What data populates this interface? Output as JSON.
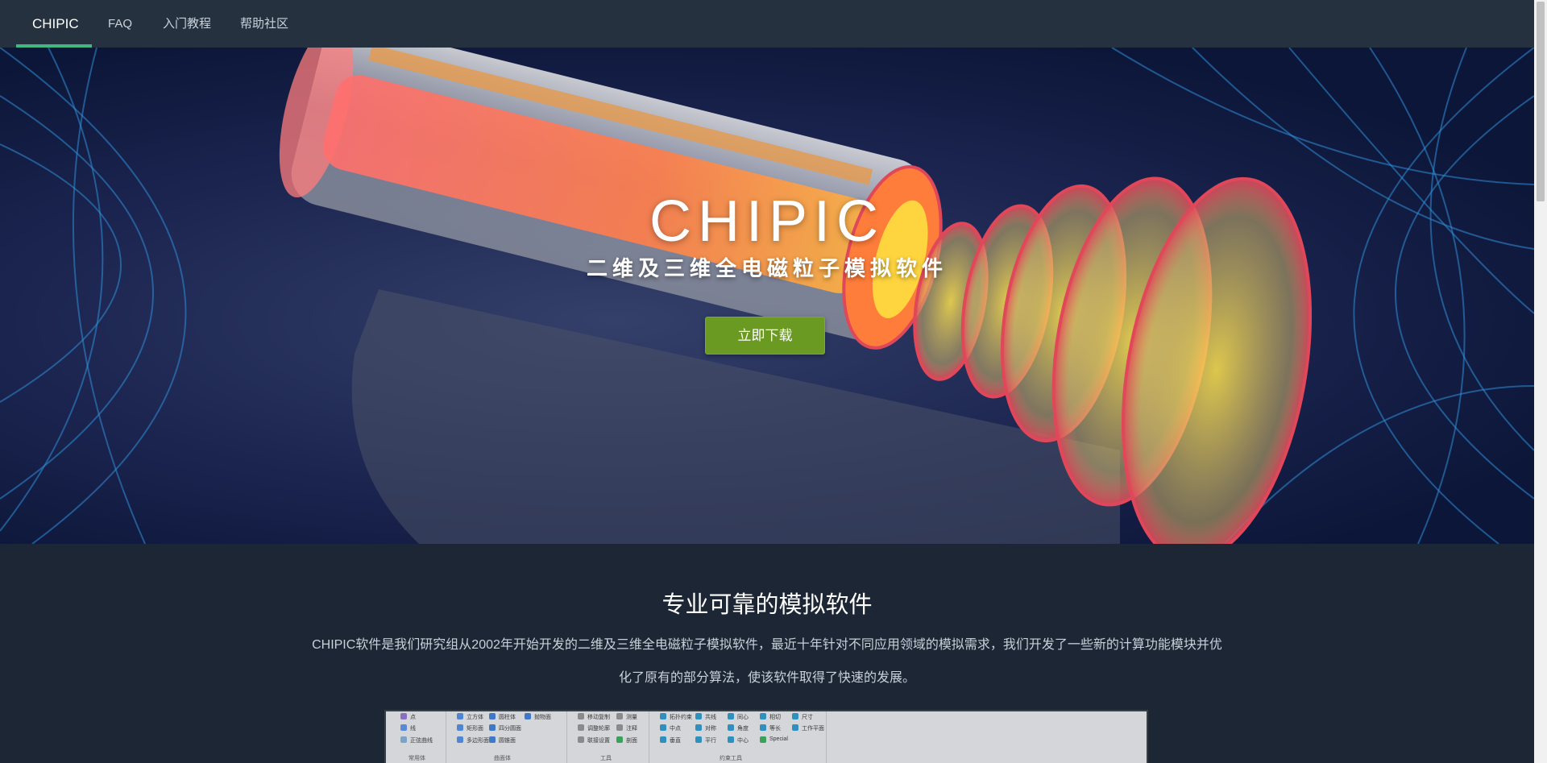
{
  "nav": {
    "items": [
      {
        "label": "CHIPIC"
      },
      {
        "label": "FAQ"
      },
      {
        "label": "入门教程"
      },
      {
        "label": "帮助社区"
      }
    ],
    "active_index": 0
  },
  "hero": {
    "title": "CHIPIC",
    "subtitle": "二维及三维全电磁粒子模拟软件",
    "download_label": "立即下载"
  },
  "intro": {
    "title": "专业可靠的模拟软件",
    "paragraph": "CHIPIC软件是我们研究组从2002年开始开发的二维及三维全电磁粒子模拟软件，最近十年针对不同应用领域的模拟需求，我们开发了一些新的计算功能模块并优化了原有的部分算法，使该软件取得了快速的发展。"
  },
  "preview": {
    "group1": {
      "items": [
        "点",
        "线",
        "正弦曲线"
      ],
      "caption": "常用体"
    },
    "group2": {
      "items": [
        "立方体",
        "矩形面",
        "多边形面",
        "圆柱体",
        "四分圆面",
        "抛物面",
        "圆锥面"
      ],
      "caption": "曲面体"
    },
    "group3": {
      "items": [
        "移动复制",
        "调整轮廓",
        "联接设置",
        "测量",
        "注释",
        "剖面"
      ],
      "caption": "工具"
    },
    "group4": {
      "items": [
        "拓扑约束",
        "中点",
        "垂直",
        "共线",
        "对称",
        "平行",
        "同心",
        "角度",
        "中心",
        "相切",
        "等长",
        "尺寸",
        "Special",
        "工作平面"
      ],
      "caption": "约束工具"
    }
  },
  "colors": {
    "nav_bg": "#26313f",
    "page_bg": "#1c2634",
    "accent": "#41b883",
    "button": "#6b9a22"
  }
}
